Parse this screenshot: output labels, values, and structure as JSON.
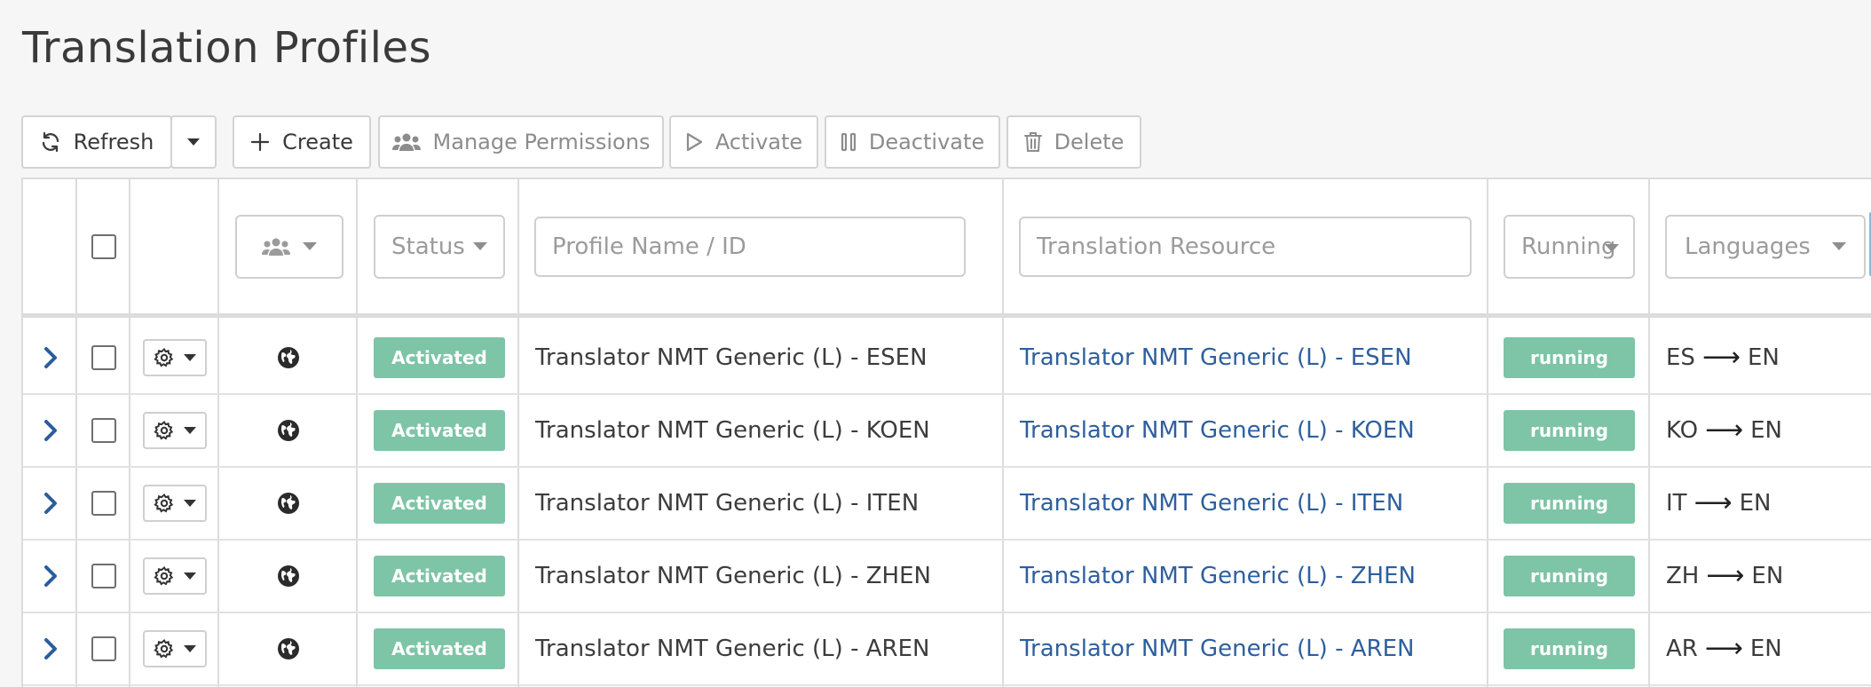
{
  "page": {
    "title": "Translation Profiles"
  },
  "toolbar": {
    "refresh": "Refresh",
    "create": "Create",
    "manage_permissions": "Manage Permissions",
    "activate": "Activate",
    "deactivate": "Deactivate",
    "delete": "Delete"
  },
  "filters": {
    "status_placeholder": "Status",
    "profile_placeholder": "Profile Name / ID",
    "resource_placeholder": "Translation Resource",
    "running_placeholder": "Running",
    "languages_placeholder": "Languages"
  },
  "rows": [
    {
      "status": "Activated",
      "profile": "Translator NMT Generic (L) - ESEN",
      "resource": "Translator NMT Generic (L) - ESEN",
      "running": "running",
      "src": "ES",
      "tgt": "EN"
    },
    {
      "status": "Activated",
      "profile": "Translator NMT Generic (L) - KOEN",
      "resource": "Translator NMT Generic (L) - KOEN",
      "running": "running",
      "src": "KO",
      "tgt": "EN"
    },
    {
      "status": "Activated",
      "profile": "Translator NMT Generic (L) - ITEN",
      "resource": "Translator NMT Generic (L) - ITEN",
      "running": "running",
      "src": "IT",
      "tgt": "EN"
    },
    {
      "status": "Activated",
      "profile": "Translator NMT Generic (L) - ZHEN",
      "resource": "Translator NMT Generic (L) - ZHEN",
      "running": "running",
      "src": "ZH",
      "tgt": "EN"
    },
    {
      "status": "Activated",
      "profile": "Translator NMT Generic (L) - AREN",
      "resource": "Translator NMT Generic (L) - AREN",
      "running": "running",
      "src": "AR",
      "tgt": "EN"
    }
  ],
  "colors": {
    "badge_green": "#7ec4a7",
    "link_blue": "#2e5f9e",
    "expand_blue": "#2a5d9c"
  },
  "icons": {
    "refresh": "refresh-icon",
    "create": "plus-icon",
    "permissions": "users-icon",
    "activate": "play-icon",
    "deactivate": "pause-icon",
    "delete": "trash-icon",
    "row_settings": "gear-icon",
    "row_scope": "globe-icon",
    "expand": "chevron-right-icon"
  }
}
